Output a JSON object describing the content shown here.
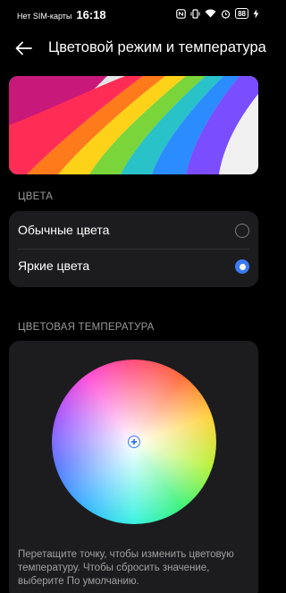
{
  "status_bar": {
    "carrier": "Нет SIM-карты",
    "time": "16:18",
    "battery": "88"
  },
  "header": {
    "back_icon": "arrow-left-icon",
    "title": "Цветовой режим и температура"
  },
  "colors_section": {
    "label": "ЦВЕТА",
    "options": [
      {
        "label": "Обычные цвета",
        "selected": false
      },
      {
        "label": "Яркие цвета",
        "selected": true
      }
    ]
  },
  "temperature_section": {
    "label": "ЦВЕТОВАЯ ТЕМПЕРАТУРА",
    "hint": "Перетащите точку, чтобы изменить цветовую температуру. Чтобы сбросить значение, выберите По умолчанию."
  },
  "colors": {
    "accent": "#3b7bf5",
    "background": "#000000",
    "card": "#1c1c1e"
  }
}
